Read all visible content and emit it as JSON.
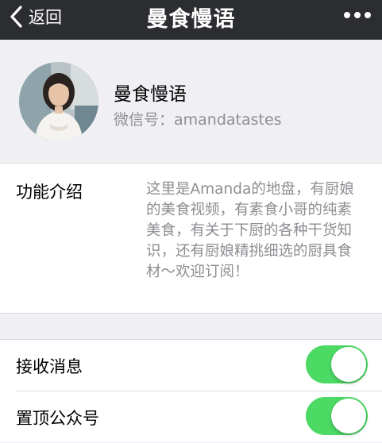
{
  "navbar": {
    "back_label": "返回",
    "title": "曼食慢语"
  },
  "profile": {
    "name": "曼食慢语",
    "wechat_id": "微信号：amandatastes"
  },
  "intro": {
    "label": "功能介绍",
    "text": "这里是Amanda的地盘，有厨娘的美食视频，有素食小哥的纯素美食，有关于下厨的各种干货知识，还有厨娘精挑细选的厨具食材～欢迎订阅！"
  },
  "settings": [
    {
      "label": "接收消息",
      "enabled": true
    },
    {
      "label": "置顶公众号",
      "enabled": true
    }
  ],
  "colors": {
    "navbar_bg": "#2b2d31",
    "toggle_on": "#4cd964",
    "secondary_text": "#8e8e93"
  },
  "icons": {
    "back": "chevron-left-icon",
    "more": "more-dots-icon"
  }
}
